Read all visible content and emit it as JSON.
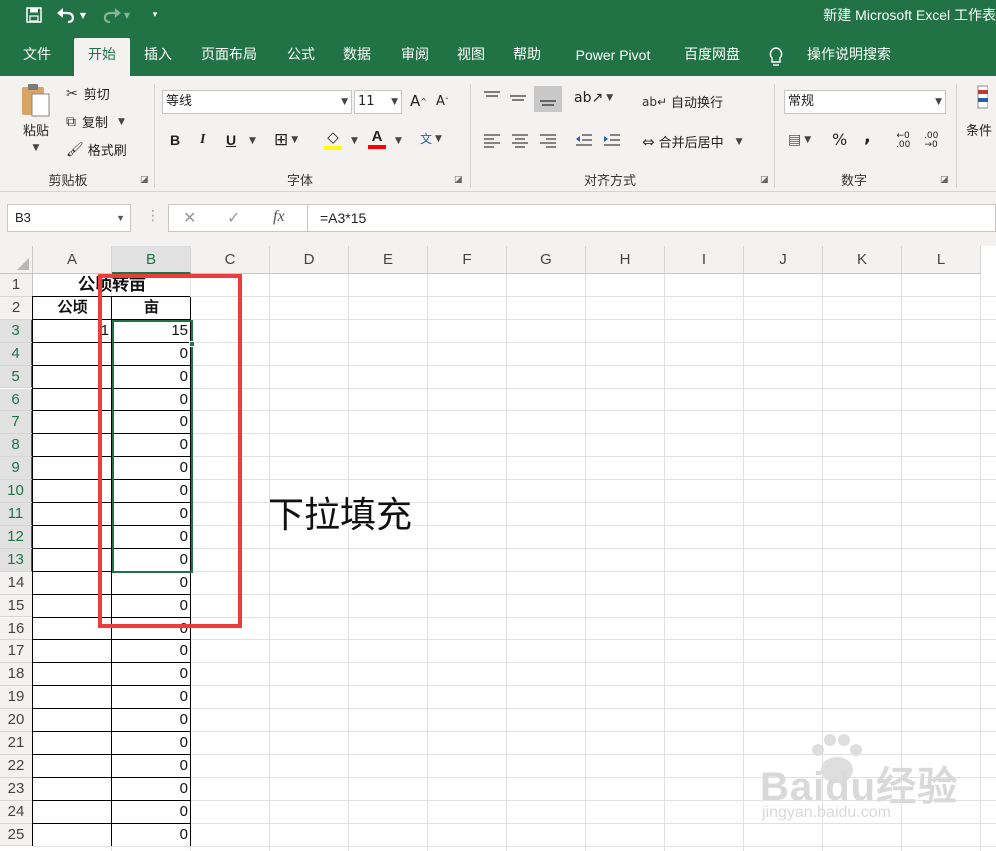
{
  "titlebar": {
    "title": "新建 Microsoft Excel 工作表",
    "quick_access": [
      "save-icon",
      "undo-icon",
      "redo-icon",
      "customize-icon"
    ]
  },
  "tabs": [
    "文件",
    "开始",
    "插入",
    "页面布局",
    "公式",
    "数据",
    "审阅",
    "视图",
    "帮助",
    "Power Pivot",
    "百度网盘",
    "操作说明搜索"
  ],
  "active_tab": "开始",
  "ribbon": {
    "clipboard": {
      "paste": "粘贴",
      "cut": "剪切",
      "copy": "复制",
      "format_painter": "格式刷",
      "group": "剪贴板"
    },
    "font": {
      "name": "等线",
      "size": "11",
      "bold": "B",
      "italic": "I",
      "underline": "U",
      "group": "字体"
    },
    "alignment": {
      "wrap_text": "自动换行",
      "merge_center": "合并后居中",
      "group": "对齐方式"
    },
    "number": {
      "format": "常规",
      "percent": "%",
      "comma": ",",
      "group": "数字"
    },
    "styles": {
      "conditional": "条件"
    }
  },
  "formula_bar": {
    "name_box": "B3",
    "formula": "=A3*15",
    "cancel": "✕",
    "enter": "✓",
    "fx": "fx"
  },
  "grid": {
    "columns": [
      "A",
      "B",
      "C",
      "D",
      "E",
      "F",
      "G",
      "H",
      "I",
      "J",
      "K",
      "L"
    ],
    "selected_column": "B",
    "rows": [
      "1",
      "2",
      "3",
      "4",
      "5",
      "6",
      "7",
      "8",
      "9",
      "10",
      "11",
      "12",
      "13",
      "14",
      "15",
      "16",
      "17",
      "18",
      "19",
      "20",
      "21",
      "22",
      "23",
      "24",
      "25"
    ],
    "selected_rows": [
      "3",
      "4",
      "5",
      "6",
      "7",
      "8",
      "9",
      "10",
      "11",
      "12",
      "13"
    ],
    "title_cell": "公顷转亩",
    "header_a": "公顷",
    "header_b": "亩",
    "a3": "1",
    "b_values": [
      "15",
      "0",
      "0",
      "0",
      "0",
      "0",
      "0",
      "0",
      "0",
      "0",
      "0",
      "0",
      "0",
      "0",
      "0",
      "0",
      "0",
      "0",
      "0",
      "0",
      "0",
      "0",
      "0"
    ]
  },
  "annotation": "下拉填充",
  "watermark": {
    "line1": "Baidu经验",
    "line2": "jingyan.baidu.com"
  },
  "colors": {
    "accent": "#217346",
    "annotation_box": "#ee3b3b"
  }
}
